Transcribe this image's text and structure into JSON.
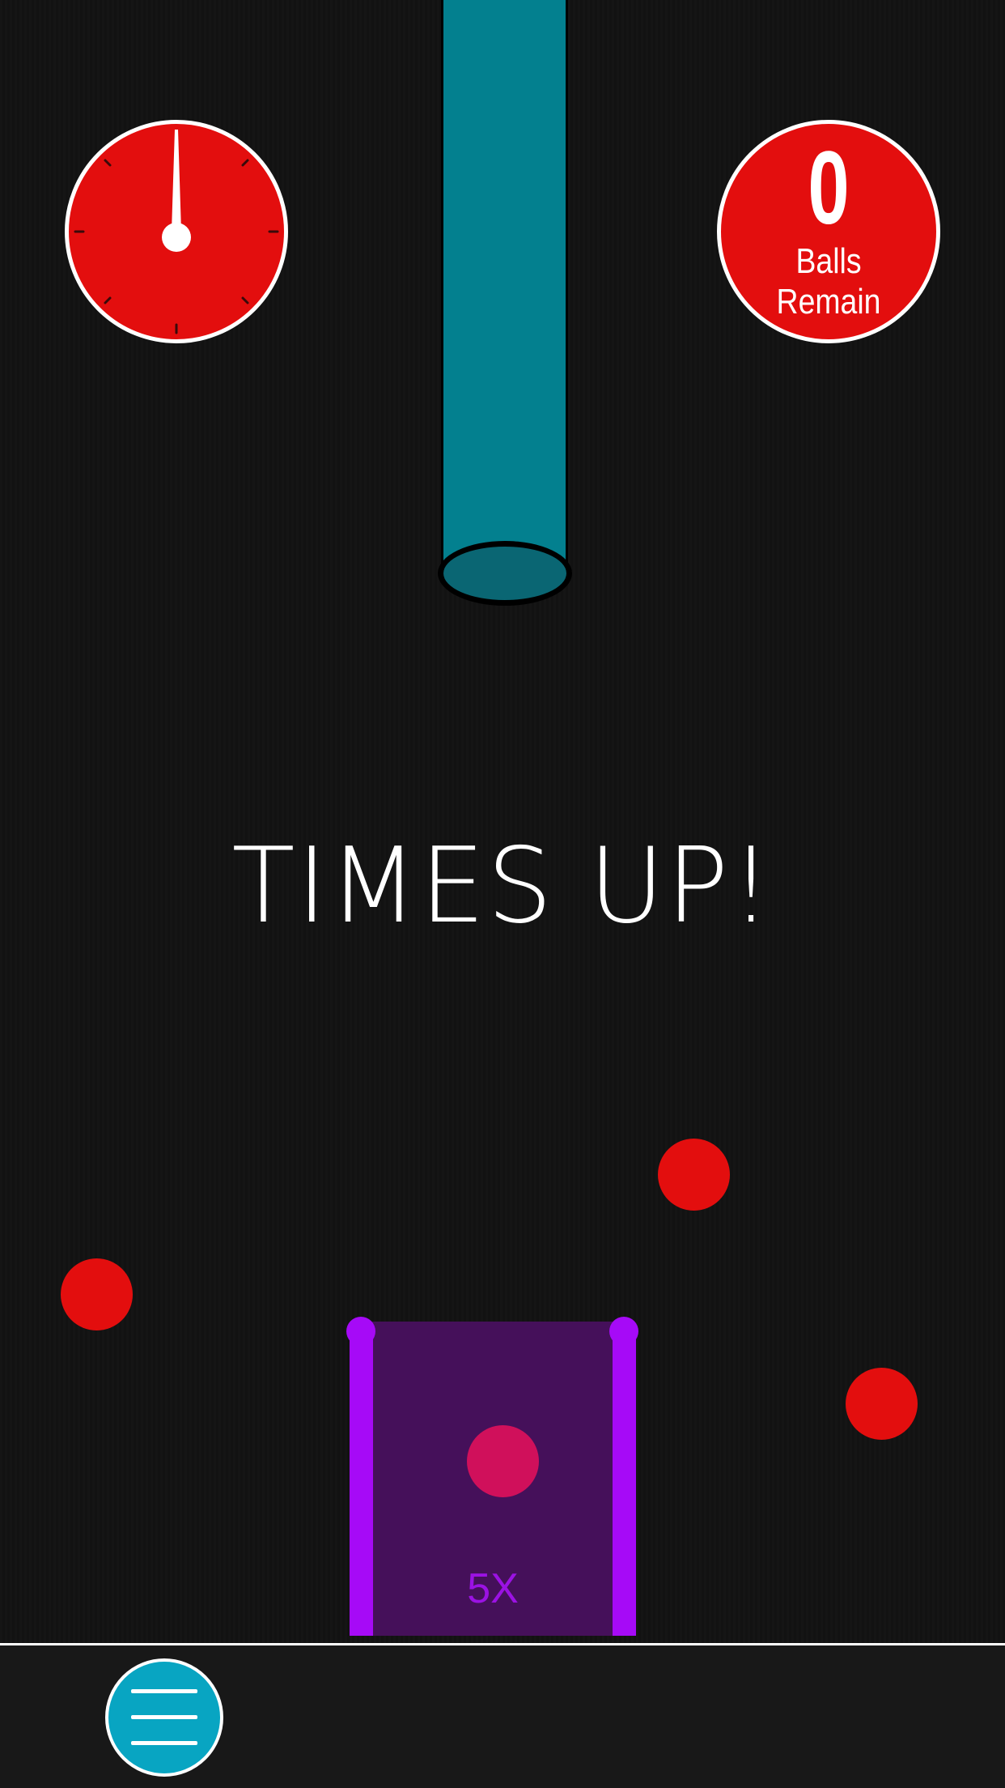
{
  "hud": {
    "timer_level": 0,
    "balls_remaining": "0",
    "balls_label_line1": "Balls",
    "balls_label_line2": "Remain"
  },
  "message": "TIMES UP!",
  "basket": {
    "multiplier": "5X"
  },
  "colors": {
    "hud_red": "#e30e0e",
    "tube": "#03808f",
    "basket_wall": "#a60af7",
    "basket_fill": "#45105a",
    "basket_ball": "#d0105b",
    "menu_button": "#08a5c2"
  },
  "icons": {
    "menu": "hamburger-icon",
    "timer": "stopwatch-dial"
  }
}
